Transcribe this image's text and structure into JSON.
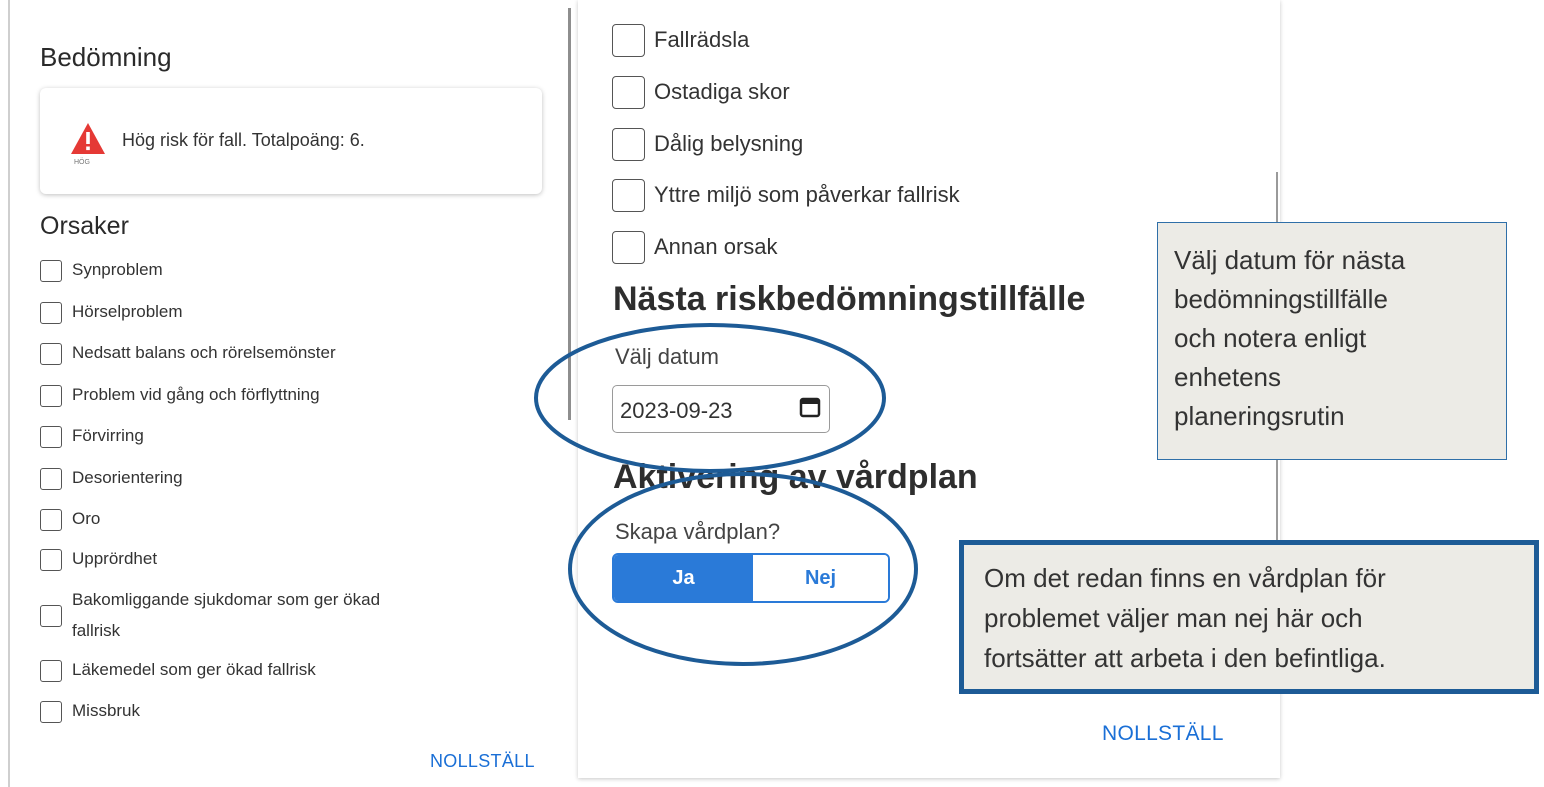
{
  "left_panel": {
    "bedomning_title": "Bedömning",
    "risk_badge": "HÖG",
    "risk_text": "Hög risk för fall. Totalpoäng: 6.",
    "orsaker_title": "Orsaker",
    "orsaker": [
      "Synproblem",
      "Hörselproblem",
      "Nedsatt balans och rörelsemönster",
      "Problem vid gång och förflyttning",
      "Förvirring",
      "Desorientering",
      "Oro",
      "Upprördhet",
      "Bakomliggande sjukdomar som ger ökad",
      "fallrisk",
      "Läkemedel som ger ökad fallrisk",
      "Missbruk"
    ],
    "reset_label": "NOLLSTÄLL"
  },
  "right_panel": {
    "orsaker": [
      "Fallrädsla",
      "Ostadiga skor",
      "Dålig belysning",
      "Yttre miljö som påverkar fallrisk",
      "Annan orsak"
    ],
    "next_title": "Nästa riskbedömningstillfälle",
    "date_label": "Välj datum",
    "date_value": "2023-09-23",
    "activation_title": "Aktivering av vårdplan",
    "create_plan_label": "Skapa vårdplan?",
    "option_yes": "Ja",
    "option_no": "Nej",
    "selected_option": "Ja",
    "reset_label": "NOLLSTÄLL"
  },
  "callouts": {
    "date_note": [
      "Välj datum för nästa",
      "bedömningstillfälle",
      "och notera enligt",
      "enhetens",
      "planeringsrutin"
    ],
    "plan_note": [
      "Om det redan finns en vårdplan för",
      "problemet väljer man nej här och",
      "fortsätter att arbeta i den befintliga."
    ]
  },
  "icons": {
    "warning": "warning-triangle-icon",
    "calendar": "calendar-icon"
  },
  "colors": {
    "accent": "#2a7ad8",
    "warning": "#e53935",
    "annotation": "#1d5b96",
    "callout_bg": "#ecebe6"
  }
}
